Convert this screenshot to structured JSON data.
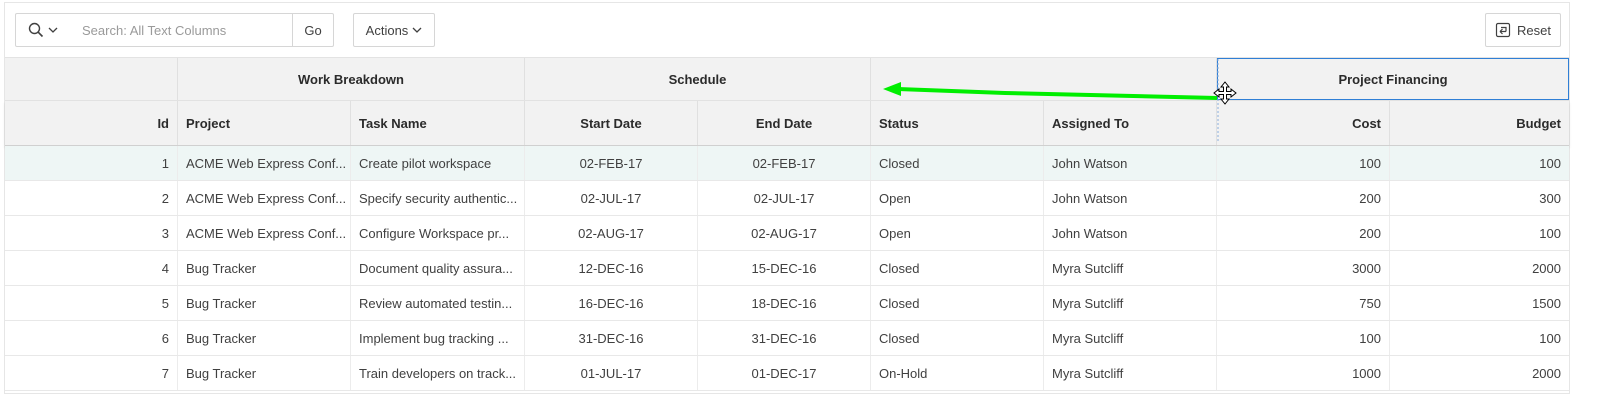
{
  "toolbar": {
    "search_placeholder": "Search: All Text Columns",
    "go_label": "Go",
    "actions_label": "Actions",
    "reset_label": "Reset"
  },
  "group_headers": {
    "work_breakdown": "Work Breakdown",
    "schedule": "Schedule",
    "project_financing": "Project Financing"
  },
  "columns": [
    "Id",
    "Project",
    "Task Name",
    "Start Date",
    "End Date",
    "Status",
    "Assigned To",
    "Cost",
    "Budget"
  ],
  "rows": [
    [
      "1",
      "ACME Web Express Conf...",
      "Create pilot workspace",
      "02-FEB-17",
      "02-FEB-17",
      "Closed",
      "John Watson",
      "100",
      "100"
    ],
    [
      "2",
      "ACME Web Express Conf...",
      "Specify security authentic...",
      "02-JUL-17",
      "02-JUL-17",
      "Open",
      "John Watson",
      "200",
      "300"
    ],
    [
      "3",
      "ACME Web Express Conf...",
      "Configure Workspace pr...",
      "02-AUG-17",
      "02-AUG-17",
      "Open",
      "John Watson",
      "200",
      "100"
    ],
    [
      "4",
      "Bug Tracker",
      "Document quality assura...",
      "12-DEC-16",
      "15-DEC-16",
      "Closed",
      "Myra Sutcliff",
      "3000",
      "2000"
    ],
    [
      "5",
      "Bug Tracker",
      "Review automated testin...",
      "16-DEC-16",
      "18-DEC-16",
      "Closed",
      "Myra Sutcliff",
      "750",
      "1500"
    ],
    [
      "6",
      "Bug Tracker",
      "Implement bug tracking ...",
      "31-DEC-16",
      "31-DEC-16",
      "Closed",
      "Myra Sutcliff",
      "100",
      "100"
    ],
    [
      "7",
      "Bug Tracker",
      "Train developers on track...",
      "01-JUL-17",
      "01-DEC-17",
      "On-Hold",
      "Myra Sutcliff",
      "1000",
      "2000"
    ]
  ],
  "selected_row": 0,
  "colors": {
    "drag_arrow": "#00ee00",
    "selection_border": "#2f7fd6",
    "selected_row_bg": "#eef6f5"
  },
  "icons": {
    "search": "search-icon",
    "chevron": "chevron-down-icon",
    "reset": "reset-icon",
    "move_cursor": "move-cursor-icon"
  }
}
